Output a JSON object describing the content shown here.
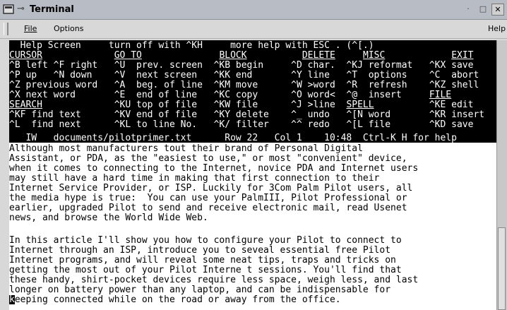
{
  "window": {
    "title": "Terminal",
    "controls": [
      "minimize",
      "maximize",
      "close"
    ]
  },
  "menu": [
    {
      "label": "File"
    },
    {
      "label": "Options"
    },
    {
      "label": "Help"
    }
  ],
  "help_screen": {
    "header": "  Help Screen     turn off with ^KH     more help with ESC . (^[.)",
    "rows": [
      "CURSOR             GO TO              BLOCK          DELETE     MISC            EXIT",
      "^B left ^F right   ^U  prev. screen  ^KB begin     ^D char.  ^KJ reformat   ^KX save",
      "^P up   ^N down    ^V  next screen   ^KK end       ^Y line   ^T  options    ^C  abort",
      "^Z previous word   ^A  beg. of line  ^KM move      ^W >word  ^R  refresh    ^KZ shell",
      "^X next word       ^E  end of line   ^KC copy      ^O word<  ^@  insert     FILE",
      "SEARCH             ^KU top of file   ^KW file      ^J >line  SPELL          ^KE edit",
      "^KF find text      ^KV end of file   ^KY delete    ^_ undo   ^[N word       ^KR insert",
      "^L  find next      ^KL to line No.   ^K/ filter    ^^ redo   ^[L file       ^KD save"
    ]
  },
  "status_line": "   IW   documents/pilotprimer.txt      Row 22   Col 1    10:48  Ctrl-K H for help",
  "document_lines": [
    "Although most manufacturers tout their brand of Personal Digital",
    "Assistant, or PDA, as the \"easiest to use,\" or most \"convenient\" device,",
    "when it comes to connecting to the Internet, novice PDA and Internet users",
    "may still have a hard time in making that first connection to their",
    "Internet Service Provider, or ISP. Luckily for 3Com Palm Pilot users, all",
    "the media hype is true:  You can use your PalmIII, Pilot Professional or",
    "earlier, upgraded Pilot to send and receive electronic mail, read Usenet",
    "news, and browse the World Wide Web.",
    "",
    "In this article I'll show you how to configure your Pilot to connect to",
    "Internet through an ISP, introduce you to seveal essential free Pilot",
    "Internet programs, and will reveal some neat tips, traps and tricks on",
    "getting the most out of your Pilot Interne t sessions. You'll find that",
    "these handy, shirt-pocket devices require less space, weigh less, and last",
    "longer on battery power than any laptop, and can be indispensable for",
    "eeping connected while on the road or away from the office."
  ],
  "cursor_char": "k"
}
